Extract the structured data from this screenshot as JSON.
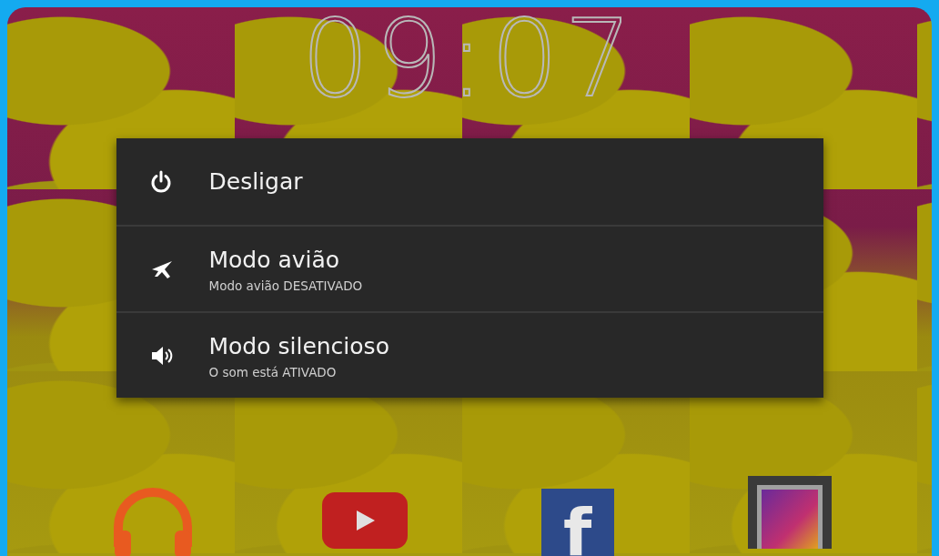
{
  "clock": "09:07",
  "menu": [
    {
      "kind": "power",
      "title": "Desligar"
    },
    {
      "kind": "airplane",
      "title": "Modo avião",
      "subtitle": "Modo avião DESATIVADO"
    },
    {
      "kind": "sound",
      "title": "Modo silencioso",
      "subtitle": "O som está ATIVADO"
    }
  ],
  "dock": [
    {
      "kind": "headphones"
    },
    {
      "kind": "video"
    },
    {
      "kind": "letter",
      "glyph": "f"
    },
    {
      "kind": "picture"
    }
  ]
}
